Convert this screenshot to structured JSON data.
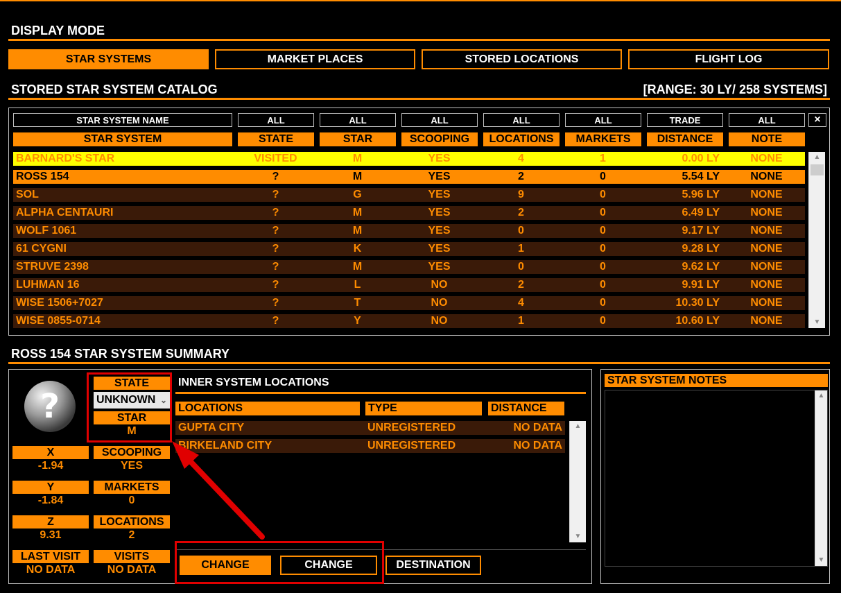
{
  "display_mode": {
    "title": "DISPLAY MODE",
    "buttons": [
      "STAR SYSTEMS",
      "MARKET PLACES",
      "STORED LOCATIONS",
      "FLIGHT LOG"
    ],
    "active": "STAR SYSTEMS"
  },
  "catalog": {
    "title": "STORED STAR SYSTEM CATALOG",
    "range": "[RANGE: 30 LY/ 258 SYSTEMS]",
    "filters": [
      "STAR SYSTEM NAME",
      "ALL",
      "ALL",
      "ALL",
      "ALL",
      "ALL",
      "TRADE",
      "ALL"
    ],
    "clear_label": "×",
    "headers": [
      "STAR SYSTEM",
      "STATE",
      "STAR",
      "SCOOPING",
      "LOCATIONS",
      "MARKETS",
      "DISTANCE",
      "NOTE"
    ],
    "rows": [
      {
        "name": "BARNARD'S STAR",
        "state": "VISITED",
        "star": "M",
        "scooping": "YES",
        "locations": "4",
        "markets": "1",
        "distance": "0.00 LY",
        "note": "NONE"
      },
      {
        "name": "ROSS 154",
        "state": "?",
        "star": "M",
        "scooping": "YES",
        "locations": "2",
        "markets": "0",
        "distance": "5.54 LY",
        "note": "NONE"
      },
      {
        "name": "SOL",
        "state": "?",
        "star": "G",
        "scooping": "YES",
        "locations": "9",
        "markets": "0",
        "distance": "5.96 LY",
        "note": "NONE"
      },
      {
        "name": "ALPHA CENTAURI",
        "state": "?",
        "star": "M",
        "scooping": "YES",
        "locations": "2",
        "markets": "0",
        "distance": "6.49 LY",
        "note": "NONE"
      },
      {
        "name": "WOLF 1061",
        "state": "?",
        "star": "M",
        "scooping": "YES",
        "locations": "0",
        "markets": "0",
        "distance": "9.17 LY",
        "note": "NONE"
      },
      {
        "name": "61 CYGNI",
        "state": "?",
        "star": "K",
        "scooping": "YES",
        "locations": "1",
        "markets": "0",
        "distance": "9.28 LY",
        "note": "NONE"
      },
      {
        "name": "STRUVE 2398",
        "state": "?",
        "star": "M",
        "scooping": "YES",
        "locations": "0",
        "markets": "0",
        "distance": "9.62 LY",
        "note": "NONE"
      },
      {
        "name": "LUHMAN 16",
        "state": "?",
        "star": "L",
        "scooping": "NO",
        "locations": "2",
        "markets": "0",
        "distance": "9.91 LY",
        "note": "NONE"
      },
      {
        "name": "WISE 1506+7027",
        "state": "?",
        "star": "T",
        "scooping": "NO",
        "locations": "4",
        "markets": "0",
        "distance": "10.30 LY",
        "note": "NONE"
      },
      {
        "name": "WISE 0855-0714",
        "state": "?",
        "star": "Y",
        "scooping": "NO",
        "locations": "1",
        "markets": "0",
        "distance": "10.60 LY",
        "note": "NONE"
      }
    ]
  },
  "summary": {
    "title": "ROSS 154 STAR SYSTEM SUMMARY",
    "state_label": "STATE",
    "state_value": "UNKNOWN",
    "star_label": "STAR",
    "star_value": "M",
    "x_label": "X",
    "x_value": "-1.94",
    "y_label": "Y",
    "y_value": "-1.84",
    "z_label": "Z",
    "z_value": "9.31",
    "scooping_label": "SCOOPING",
    "scooping_value": "YES",
    "markets_label": "MARKETS",
    "markets_value": "0",
    "locations_label": "LOCATIONS",
    "locations_value": "2",
    "last_visit_label": "LAST VISIT",
    "last_visit_value": "NO DATA",
    "visits_label": "VISITS",
    "visits_value": "NO DATA",
    "inner_title": "INNER SYSTEM LOCATIONS",
    "loc_headers": [
      "LOCATIONS",
      "TYPE",
      "DISTANCE"
    ],
    "locations": [
      {
        "name": "GUPTA CITY",
        "type": "UNREGISTERED",
        "distance": "NO DATA"
      },
      {
        "name": "BIRKELAND CITY",
        "type": "UNREGISTERED",
        "distance": "NO DATA"
      }
    ],
    "buttons": [
      "CHANGE",
      "CHANGE",
      "DESTINATION"
    ],
    "notes_title": "STAR SYSTEM NOTES"
  },
  "colors": {
    "accent": "#ff8c00",
    "row_bg": "#3a1a08",
    "highlight": "#ffff00",
    "annotation": "#e00000"
  }
}
